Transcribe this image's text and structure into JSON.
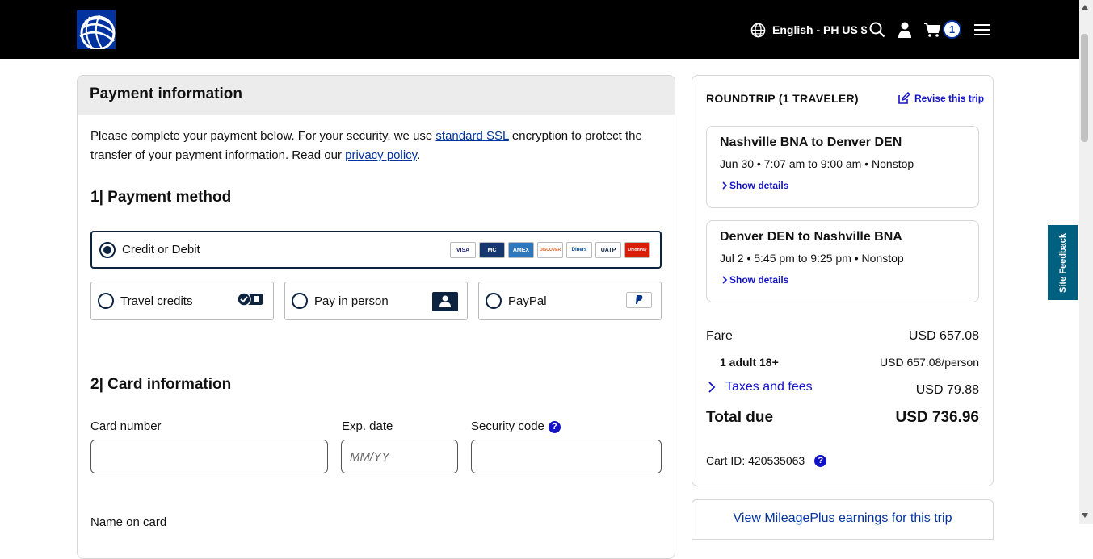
{
  "header": {
    "language": "English - PH US $",
    "cart_count": "1"
  },
  "payment": {
    "title": "Payment information",
    "intro_before": "Please complete your payment below. For your security, we use ",
    "ssl_link": "standard SSL",
    "intro_middle": " encryption to protect the transfer of your payment information. Read our ",
    "privacy_link": "privacy policy",
    "intro_after": ".",
    "method_title": "1| Payment method",
    "methods": {
      "credit": "Credit or Debit",
      "travel_credits": "Travel credits",
      "pay_in_person": "Pay in person",
      "paypal": "PayPal"
    },
    "card_logos": [
      "VISA",
      "MC",
      "AMEX",
      "DISCOVER",
      "Diners",
      "UATP",
      "UnionPay"
    ],
    "card_title": "2| Card information",
    "card_number_label": "Card number",
    "exp_label": "Exp. date",
    "exp_placeholder": "MM/YY",
    "security_label": "Security code",
    "name_label_partial": "Name on card"
  },
  "trip": {
    "title": "ROUNDTRIP (1 TRAVELER)",
    "revise": "Revise this trip",
    "flights": [
      {
        "route": "Nashville BNA to Denver DEN",
        "time": "Jun 30 • 7:07 am to 9:00 am • Nonstop",
        "details": "Show details"
      },
      {
        "route": "Denver DEN to Nashville BNA",
        "time": "Jul 2 • 5:45 pm to 9:25 pm • Nonstop",
        "details": "Show details"
      }
    ],
    "fare_label": "Fare",
    "fare_value": "USD 657.08",
    "adult_label": "1 adult 18+",
    "adult_value": "USD 657.08/person",
    "taxes_label": "Taxes and fees",
    "taxes_value": "USD 79.88",
    "total_label": "Total due",
    "total_value": "USD 736.96",
    "cart_id": "Cart ID: 420535063"
  },
  "mileage_link": "View MileagePlus earnings for this trip",
  "feedback": "Site Feedback",
  "colors": {
    "accent": "#1212c9",
    "header_bg": "#000000",
    "brand_blue": "#0033a0"
  }
}
